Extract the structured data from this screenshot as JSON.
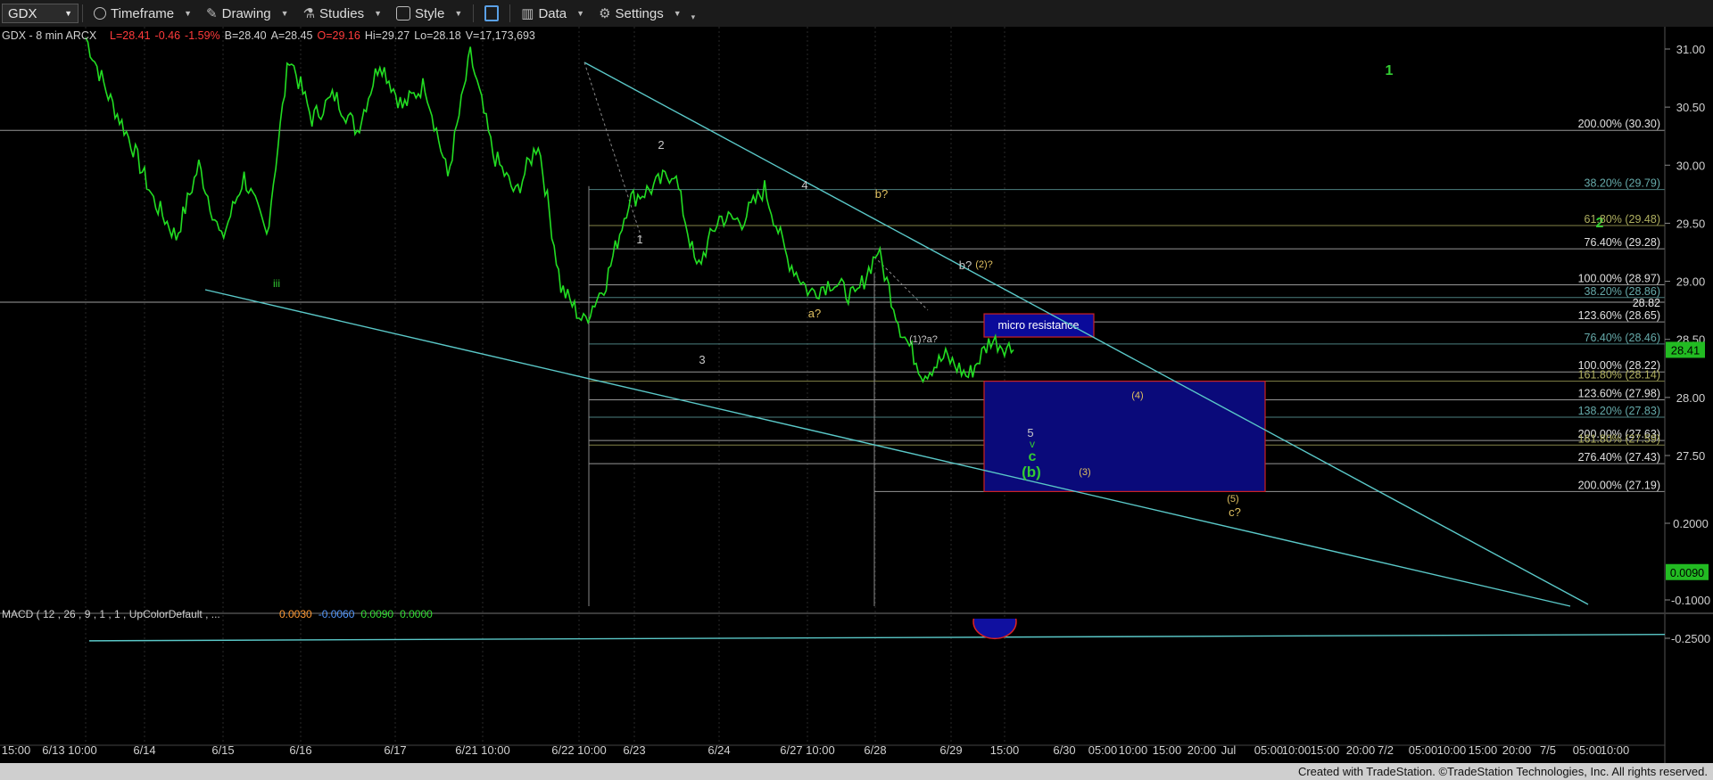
{
  "toolbar": {
    "symbol": "GDX",
    "items": [
      {
        "label": "Timeframe",
        "icon": "clock-icon"
      },
      {
        "label": "Drawing",
        "icon": "pen-icon"
      },
      {
        "label": "Studies",
        "icon": "flask-icon"
      },
      {
        "label": "Style",
        "icon": "style-icon"
      },
      {
        "label": "",
        "icon": "layout-icon"
      },
      {
        "label": "Data",
        "icon": "bar-chart-icon"
      },
      {
        "label": "Settings",
        "icon": "gear-icon"
      }
    ]
  },
  "header": {
    "symbol_info": "GDX - 8 min  ARCX",
    "stats": [
      {
        "text": "L=28.41",
        "color": "#ff3b3b"
      },
      {
        "text": "-0.46",
        "color": "#ff3b3b"
      },
      {
        "text": "-1.59%",
        "color": "#ff3b3b"
      },
      {
        "text": "B=28.40",
        "color": "#d0d0d0"
      },
      {
        "text": "A=28.45",
        "color": "#d0d0d0"
      },
      {
        "text": "O=29.16",
        "color": "#ff3b3b"
      },
      {
        "text": "Hi=29.27",
        "color": "#d0d0d0"
      },
      {
        "text": "Lo=28.18",
        "color": "#d0d0d0"
      },
      {
        "text": "V=17,173,693",
        "color": "#d0d0d0"
      }
    ]
  },
  "macd_header": {
    "label": "MACD ( 12 , 26 , 9 , 1 , 1 , UpColorDefault , ...",
    "values": [
      {
        "text": "0.0030",
        "color": "#ff9933"
      },
      {
        "text": "-0.0060",
        "color": "#5599ff"
      },
      {
        "text": "0.0090",
        "color": "#33dd33"
      },
      {
        "text": "0.0000",
        "color": "#33dd33"
      }
    ]
  },
  "chart_data": {
    "type": "line",
    "title": "GDX - 8 min",
    "price_axis": {
      "ylim": [
        27.15,
        31.15
      ],
      "ticks": [
        "31.00",
        "30.50",
        "30.00",
        "29.50",
        "29.00",
        "28.50",
        "28.00",
        "27.50"
      ],
      "last_price": "28.41",
      "marker_2882": "28.82"
    },
    "macd_axis": {
      "ylim": [
        -0.33,
        0.28
      ],
      "ticks": [
        "0.2000",
        "-0.1000",
        "-0.2500"
      ],
      "marker": "0.0090"
    },
    "x_labels": [
      "15:00",
      "6/13 10:00",
      "6/14",
      "6/15",
      "6/16",
      "6/17",
      "6/21 10:00",
      "6/22 10:00",
      "6/23",
      "6/24",
      "6/27 10:00",
      "6/28",
      "6/29",
      "15:00",
      "6/30",
      "05:00",
      "10:00",
      "15:00",
      "20:00",
      "Jul",
      "05:00",
      "10:00",
      "15:00",
      "20:00",
      "7/2",
      "05:00",
      "10:00",
      "15:00",
      "20:00",
      "7/5",
      "05:00",
      "10:00"
    ],
    "price_series": [
      {
        "x": 0,
        "y": 31.1
      },
      {
        "x": 1,
        "y": 30.6
      },
      {
        "x": 2,
        "y": 30.2
      },
      {
        "x": 3,
        "y": 29.7
      },
      {
        "x": 4,
        "y": 29.38
      },
      {
        "x": 5,
        "y": 30.0
      },
      {
        "x": 6,
        "y": 29.35
      },
      {
        "x": 7,
        "y": 29.9
      },
      {
        "x": 8,
        "y": 29.4
      },
      {
        "x": 9,
        "y": 30.95
      },
      {
        "x": 10,
        "y": 30.4
      },
      {
        "x": 11,
        "y": 30.6
      },
      {
        "x": 12,
        "y": 30.3
      },
      {
        "x": 13,
        "y": 30.9
      },
      {
        "x": 14,
        "y": 30.5
      },
      {
        "x": 15,
        "y": 30.7
      },
      {
        "x": 16,
        "y": 29.9
      },
      {
        "x": 17,
        "y": 30.95
      },
      {
        "x": 18,
        "y": 30.1
      },
      {
        "x": 19,
        "y": 29.75
      },
      {
        "x": 20,
        "y": 30.2
      },
      {
        "x": 21,
        "y": 28.95
      },
      {
        "x": 22,
        "y": 28.65
      },
      {
        "x": 23,
        "y": 29.0
      },
      {
        "x": 24,
        "y": 29.7
      },
      {
        "x": 25,
        "y": 29.8
      },
      {
        "x": 26,
        "y": 29.95
      },
      {
        "x": 27,
        "y": 29.1
      },
      {
        "x": 28,
        "y": 29.55
      },
      {
        "x": 29,
        "y": 29.52
      },
      {
        "x": 30,
        "y": 29.8
      },
      {
        "x": 31,
        "y": 29.2
      },
      {
        "x": 32,
        "y": 28.9
      },
      {
        "x": 33,
        "y": 29.0
      },
      {
        "x": 34,
        "y": 28.85
      },
      {
        "x": 35,
        "y": 29.27
      },
      {
        "x": 36,
        "y": 28.6
      },
      {
        "x": 37,
        "y": 28.2
      },
      {
        "x": 38,
        "y": 28.35
      },
      {
        "x": 39,
        "y": 28.18
      },
      {
        "x": 40,
        "y": 28.5
      },
      {
        "x": 41,
        "y": 28.41
      }
    ],
    "fib_levels": [
      {
        "label": "200.00% (30.30)",
        "value": 30.3,
        "color": "#c8c8c8"
      },
      {
        "label": "38.20% (29.79)",
        "value": 29.79,
        "color": "#66aaaa"
      },
      {
        "label": "61.80% (29.48)",
        "value": 29.48,
        "color": "#b0b060"
      },
      {
        "label": "76.40% (29.28)",
        "value": 29.28,
        "color": "#c8c8c8"
      },
      {
        "label": "100.00% (28.97)",
        "value": 28.97,
        "color": "#c8c8c8"
      },
      {
        "label": "38.20% (28.86)",
        "value": 28.86,
        "color": "#66aaaa"
      },
      {
        "label": "123.60% (28.65)",
        "value": 28.65,
        "color": "#c8c8c8"
      },
      {
        "label": "76.40% (28.46)",
        "value": 28.46,
        "color": "#66aaaa"
      },
      {
        "label": "100.00% (28.22)",
        "value": 28.22,
        "color": "#c8c8c8"
      },
      {
        "label": "161.80% (28.14)",
        "value": 28.14,
        "color": "#b0b060"
      },
      {
        "label": "123.60% (27.98)",
        "value": 27.98,
        "color": "#c8c8c8"
      },
      {
        "label": "138.20% (27.83)",
        "value": 27.83,
        "color": "#66aaaa"
      },
      {
        "label": "200.00% (27.63)",
        "value": 27.63,
        "color": "#c8c8c8"
      },
      {
        "label": "161.80% (27.59)",
        "value": 27.59,
        "color": "#b0b060"
      },
      {
        "label": "276.40% (27.43)",
        "value": 27.43,
        "color": "#c8c8c8"
      },
      {
        "label": "200.00% (27.19)",
        "value": 27.19,
        "color": "#c8c8c8"
      }
    ],
    "annotations": [
      {
        "text": "1",
        "color": "#33cc33",
        "x": 1557,
        "y": 54,
        "size": 16,
        "bold": true
      },
      {
        "text": "2",
        "color": "#33cc33",
        "x": 1793,
        "y": 225,
        "size": 16,
        "bold": true
      },
      {
        "text": "iii",
        "color": "#33cc33",
        "x": 310,
        "y": 292,
        "size": 12
      },
      {
        "text": "2",
        "color": "#c8c8c8",
        "x": 741,
        "y": 137,
        "size": 13
      },
      {
        "text": "1",
        "color": "#c8c8c8",
        "x": 717,
        "y": 243,
        "size": 13
      },
      {
        "text": "3",
        "color": "#c8c8c8",
        "x": 787,
        "y": 378,
        "size": 13
      },
      {
        "text": "4",
        "color": "#c8c8c8",
        "x": 902,
        "y": 182,
        "size": 13
      },
      {
        "text": "a?",
        "color": "#e0c060",
        "x": 913,
        "y": 326,
        "size": 13
      },
      {
        "text": "b?",
        "color": "#e0c060",
        "x": 988,
        "y": 192,
        "size": 13
      },
      {
        "text": "b?",
        "color": "#c8c8c8",
        "x": 1082,
        "y": 272,
        "size": 13
      },
      {
        "text": "(2)?",
        "color": "#e0c060",
        "x": 1103,
        "y": 270,
        "size": 11
      },
      {
        "text": "(1)?a?",
        "color": "#c8c8c8",
        "x": 1035,
        "y": 354,
        "size": 11
      },
      {
        "text": "(4)",
        "color": "#e0c060",
        "x": 1275,
        "y": 417,
        "size": 11
      },
      {
        "text": "5",
        "color": "#c8c8c8",
        "x": 1155,
        "y": 460,
        "size": 13
      },
      {
        "text": "v",
        "color": "#33cc33",
        "x": 1157,
        "y": 472,
        "size": 12
      },
      {
        "text": "c",
        "color": "#33cc33",
        "x": 1157,
        "y": 487,
        "size": 16,
        "bold": true
      },
      {
        "text": "(b)",
        "color": "#33cc33",
        "x": 1156,
        "y": 505,
        "size": 17,
        "bold": true
      },
      {
        "text": "(3)",
        "color": "#e0c060",
        "x": 1216,
        "y": 503,
        "size": 11
      },
      {
        "text": "(5)",
        "color": "#e0c060",
        "x": 1382,
        "y": 533,
        "size": 11
      },
      {
        "text": "c?",
        "color": "#e0c060",
        "x": 1384,
        "y": 549,
        "size": 13
      }
    ],
    "micro_resistance": "micro resistance"
  },
  "footer": {
    "text": "Created with TradeStation. ©TradeStation Technologies, Inc. All rights reserved."
  }
}
